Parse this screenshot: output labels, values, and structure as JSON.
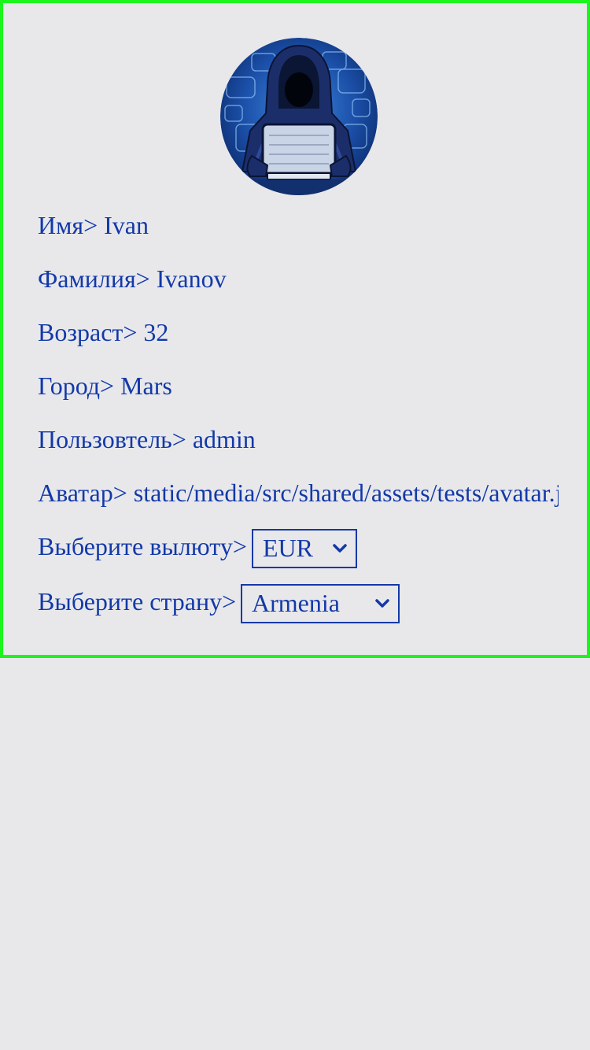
{
  "profile": {
    "avatar_icon": "hacker-avatar-icon",
    "fields": {
      "first_name_label": "Имя>",
      "first_name_value": "Ivan",
      "last_name_label": "Фамилия>",
      "last_name_value": "Ivanov",
      "age_label": "Возраст>",
      "age_value": "32",
      "city_label": "Город>",
      "city_value": "Mars",
      "user_label": "Пользовтель>",
      "user_value": "admin",
      "avatar_label": "Аватар>",
      "avatar_value": "static/media/src/shared/assets/tests/avatar.jpg"
    },
    "currency": {
      "label": "Выберите вылюту>",
      "selected": "EUR"
    },
    "country": {
      "label": "Выберите страну>",
      "selected": "Armenia"
    }
  },
  "colors": {
    "text": "#1339a8",
    "border": "#1cf51c",
    "background": "#e8e8eb"
  }
}
